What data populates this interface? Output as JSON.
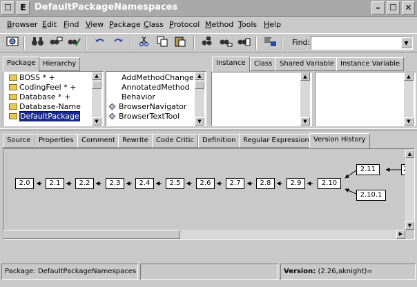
{
  "window": {
    "title": "DefaultPackageNamespaces",
    "close_glyph": "☐",
    "menu_glyph": "E",
    "min_glyph": "–",
    "max_glyph": "☐",
    "x_glyph": "✕"
  },
  "menubar": [
    {
      "id": "browser",
      "label": "Browser"
    },
    {
      "id": "edit",
      "label": "Edit"
    },
    {
      "id": "find",
      "label": "Find"
    },
    {
      "id": "view",
      "label": "View"
    },
    {
      "id": "package",
      "label": "Package"
    },
    {
      "id": "class",
      "label": "Class"
    },
    {
      "id": "protocol",
      "label": "Protocol"
    },
    {
      "id": "method",
      "label": "Method"
    },
    {
      "id": "tools",
      "label": "Tools"
    },
    {
      "id": "help",
      "label": "Help"
    }
  ],
  "toolbar": {
    "find_label": "Find:",
    "find_value": "",
    "icons": [
      "browser-icon",
      "binoculars-icon",
      "find-chat-icon",
      "find-wand-icon",
      "undo-icon",
      "redo-icon",
      "cut-icon",
      "copy-icon",
      "paste-icon",
      "find-class-icon",
      "find-method-icon",
      "find-references-icon",
      "format-icon"
    ]
  },
  "upper_tabs": {
    "left": [
      "Package",
      "Hierarchy"
    ],
    "right": [
      "Instance",
      "Class",
      "Shared Variable",
      "Instance Variable"
    ]
  },
  "package_list": [
    {
      "label": "BOSS * +",
      "selected": false
    },
    {
      "label": "CodingFeel * +",
      "selected": false
    },
    {
      "label": "Database * +",
      "selected": false
    },
    {
      "label": "Database-Name",
      "selected": false
    },
    {
      "label": "DefaultPackage",
      "selected": true
    }
  ],
  "class_list": [
    {
      "label": "AddMethodChange",
      "icon": false
    },
    {
      "label": "AnnotatedMethod",
      "icon": false
    },
    {
      "label": "Behavior",
      "icon": false
    },
    {
      "label": "BrowserNavigator",
      "icon": true
    },
    {
      "label": "BrowserTextTool",
      "icon": true
    }
  ],
  "lower_tabs": [
    "Source",
    "Properties",
    "Comment",
    "Rewrite",
    "Code Critic",
    "Definition",
    "Regular Expression",
    "Version History"
  ],
  "active_lower_tab": "Version History",
  "version_history": {
    "main_chain": [
      "2.0",
      "2.1",
      "2.2",
      "2.3",
      "2.4",
      "2.5",
      "2.6",
      "2.7",
      "2.8",
      "2.9",
      "2.10"
    ],
    "branch_upper": "2.11",
    "branch_lower": "2.10.1",
    "partial_right": "2"
  },
  "status": {
    "package_label": "Package:",
    "package_value": "DefaultPackageNamespaces",
    "middle": "",
    "version_label": "Version:",
    "version_value": "(2.26,aknight)="
  }
}
